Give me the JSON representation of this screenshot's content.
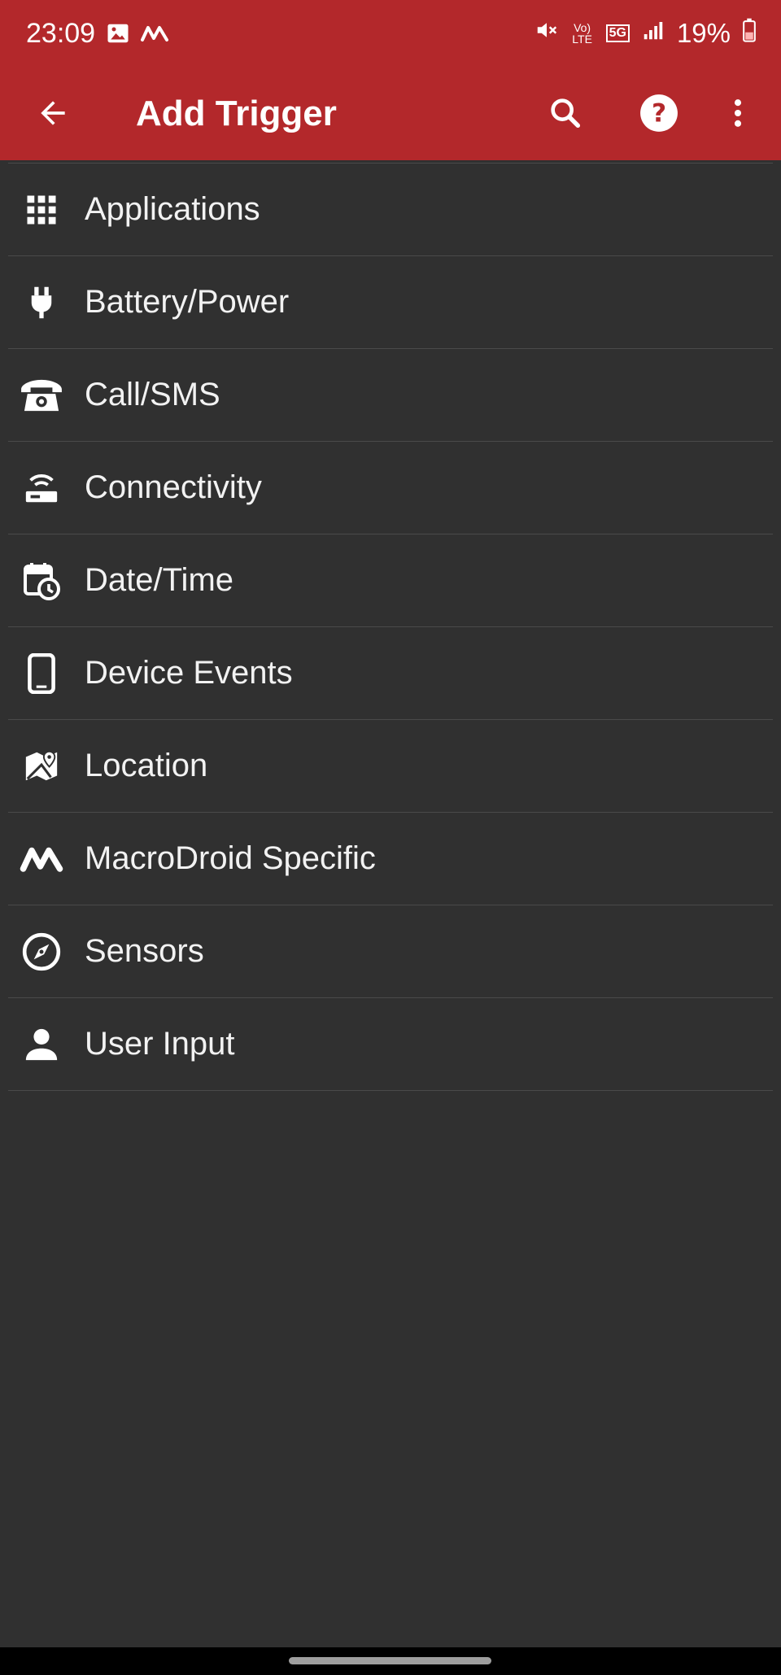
{
  "status_bar": {
    "time": "23:09",
    "battery_percent": "19%",
    "network": "5G",
    "volte_label": "Vo) LTE",
    "icons": [
      "gallery-icon",
      "macrodroid-icon",
      "mute-icon",
      "volte-icon",
      "5g-icon",
      "signal-icon",
      "battery-icon"
    ]
  },
  "toolbar": {
    "title": "Add Trigger",
    "icons": [
      "back-arrow-icon",
      "search-icon",
      "help-icon",
      "more-vert-icon"
    ],
    "accent_color": "#b3282b"
  },
  "categories": [
    {
      "label": "Applications",
      "icon": "apps-grid-icon"
    },
    {
      "label": "Battery/Power",
      "icon": "power-plug-icon"
    },
    {
      "label": "Call/SMS",
      "icon": "phone-icon"
    },
    {
      "label": "Connectivity",
      "icon": "router-icon"
    },
    {
      "label": "Date/Time",
      "icon": "calendar-clock-icon"
    },
    {
      "label": "Device Events",
      "icon": "device-icon"
    },
    {
      "label": "Location",
      "icon": "map-pin-icon"
    },
    {
      "label": "MacroDroid Specific",
      "icon": "macrodroid-icon"
    },
    {
      "label": "Sensors",
      "icon": "compass-icon"
    },
    {
      "label": "User Input",
      "icon": "person-icon"
    }
  ]
}
